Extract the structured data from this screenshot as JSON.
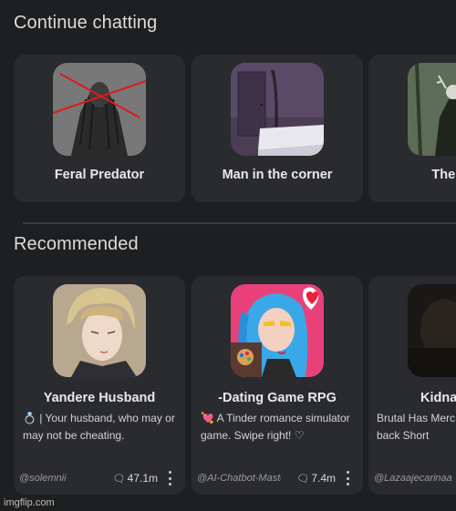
{
  "continue": {
    "title": "Continue chatting",
    "items": [
      {
        "name": "Feral Predator"
      },
      {
        "name": "Man in the corner"
      },
      {
        "name": "The we"
      }
    ]
  },
  "recommended": {
    "title": "Recommended",
    "items": [
      {
        "name": "Yandere Husband",
        "description": "💍 | Your husband, who may or may not be cheating.",
        "author": "@solemnii",
        "chats": "47.1m"
      },
      {
        "name": "-Dating Game RPG",
        "description": "💘 A Tinder romance simulator game. Swipe right! ♡",
        "author": "@AI-Chatbot-Master",
        "chats": "7.4m"
      },
      {
        "name": "Kidna",
        "description": "Brutal Has Merc Laid back Short",
        "author": "@Lazaajecarinaa"
      }
    ]
  },
  "watermark": "imgflip.com"
}
